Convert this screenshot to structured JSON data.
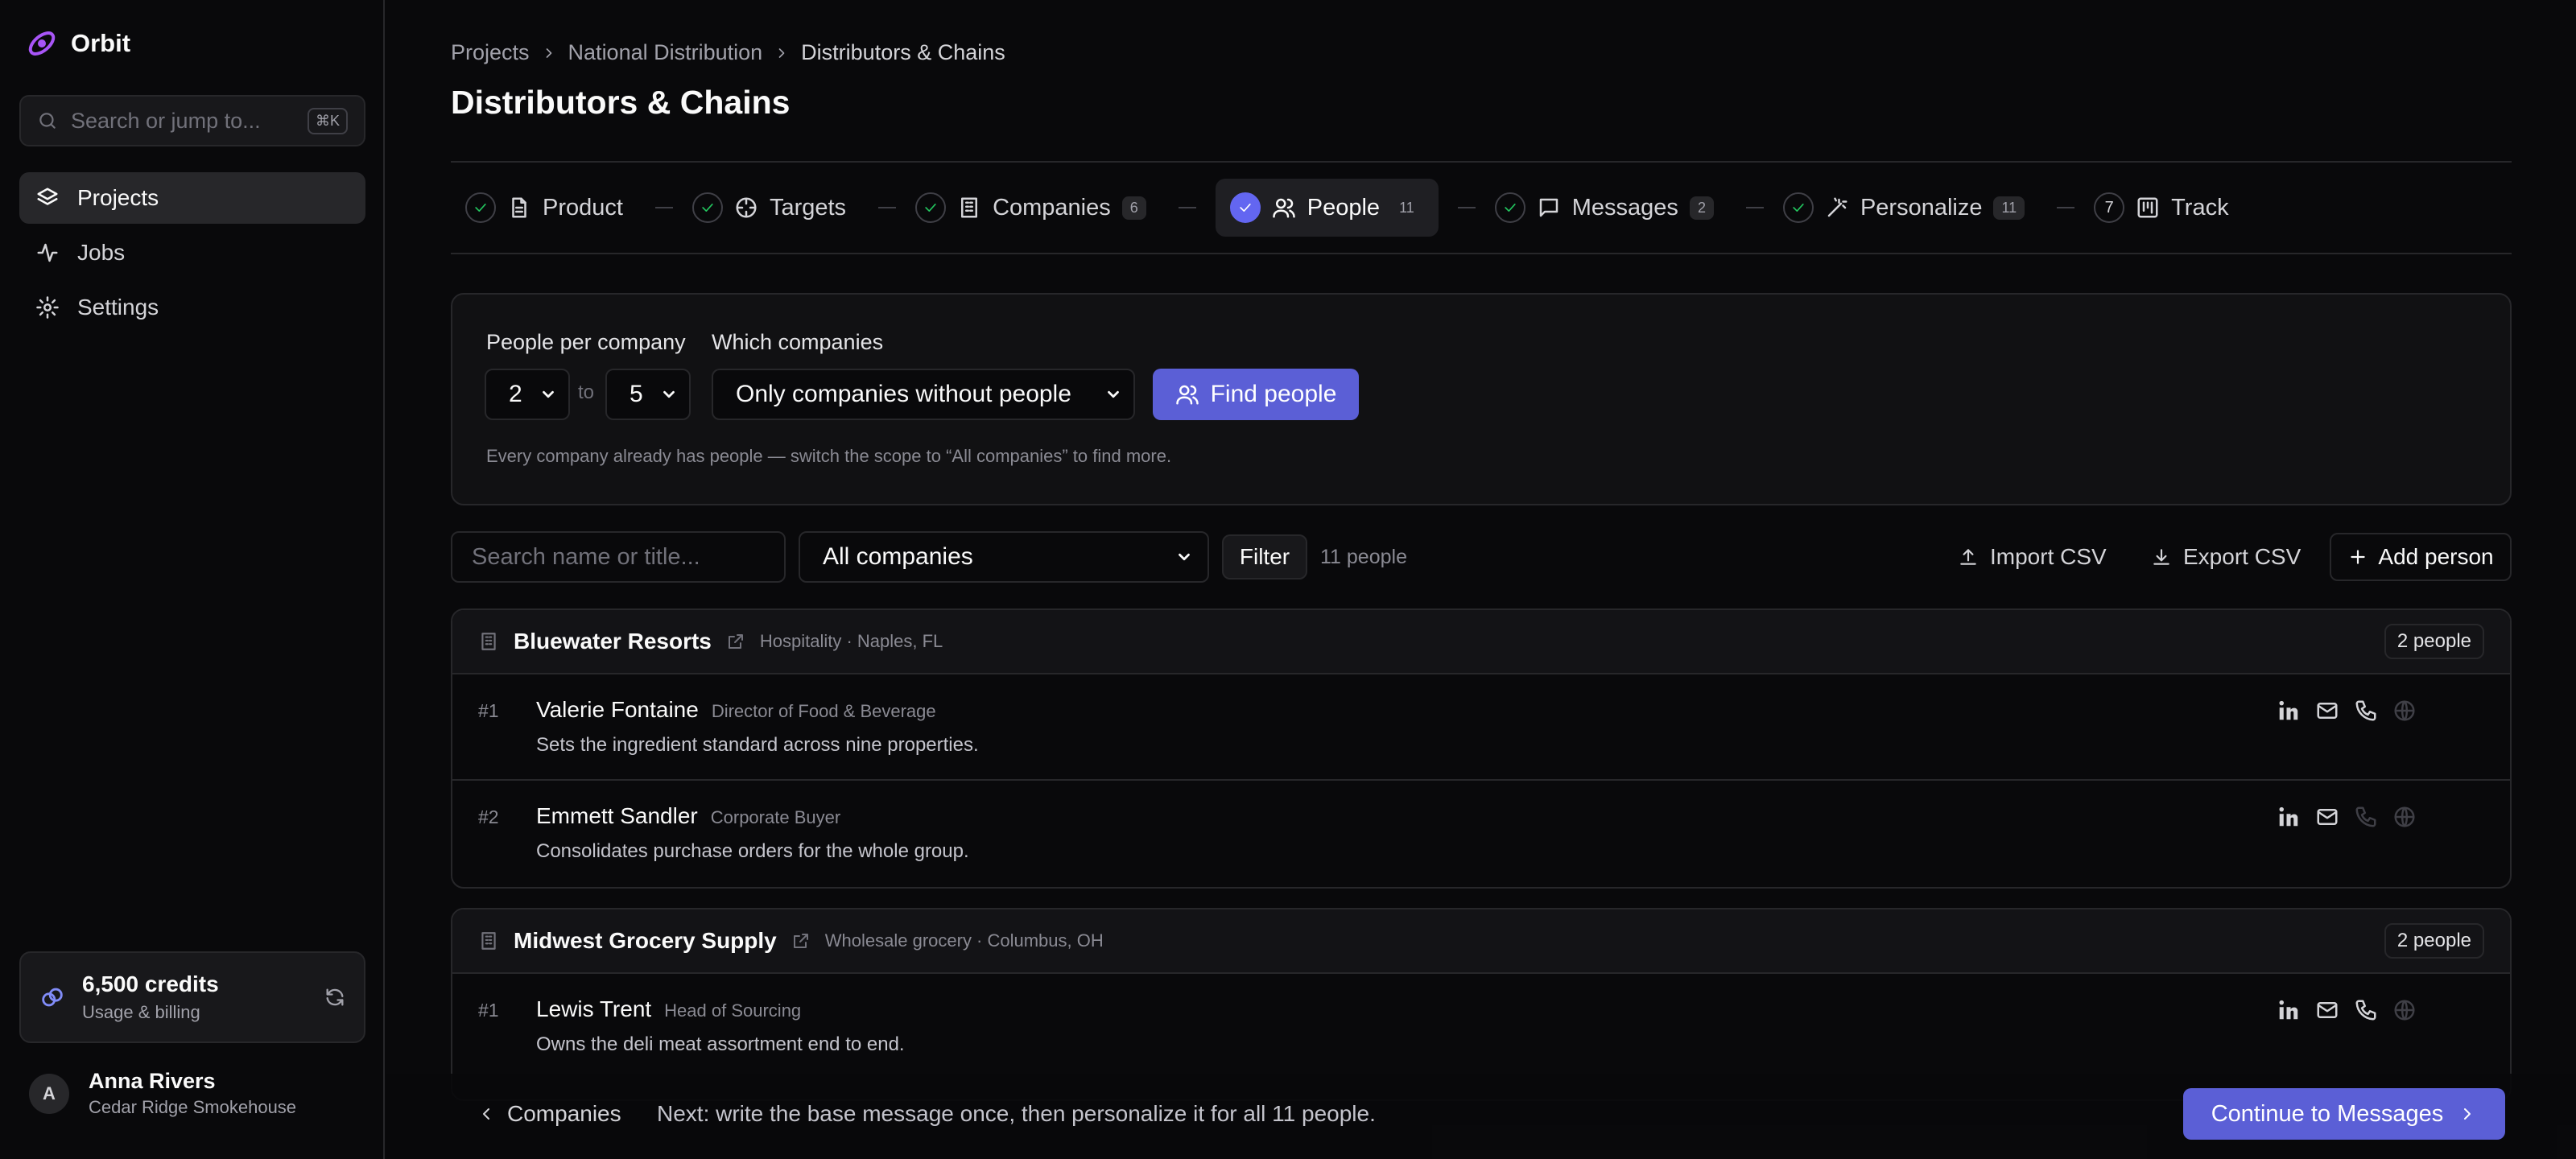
{
  "app": {
    "name": "Orbit"
  },
  "search": {
    "placeholder": "Search or jump to...",
    "shortcut": "⌘K"
  },
  "nav": [
    {
      "label": "Projects",
      "icon": "layers-icon",
      "active": true
    },
    {
      "label": "Jobs",
      "icon": "activity-icon",
      "active": false
    },
    {
      "label": "Settings",
      "icon": "gear-icon",
      "active": false
    }
  ],
  "credits": {
    "amount": "6,500 credits",
    "sub": "Usage & billing"
  },
  "user": {
    "initial": "A",
    "name": "Anna Rivers",
    "company": "Cedar Ridge Smokehouse"
  },
  "breadcrumb": [
    "Projects",
    "National Distribution",
    "Distributors & Chains"
  ],
  "page": {
    "title": "Distributors & Chains"
  },
  "steps": [
    {
      "label": "Product",
      "count": "",
      "state": "done",
      "icon": "document-icon"
    },
    {
      "label": "Targets",
      "count": "",
      "state": "done",
      "icon": "crosshair-icon"
    },
    {
      "label": "Companies",
      "count": "6",
      "state": "done",
      "icon": "building-icon"
    },
    {
      "label": "People",
      "count": "11",
      "state": "active",
      "icon": "users-icon"
    },
    {
      "label": "Messages",
      "count": "2",
      "state": "done",
      "icon": "message-icon"
    },
    {
      "label": "Personalize",
      "count": "11",
      "state": "done",
      "icon": "wand-icon"
    },
    {
      "label": "Track",
      "count": "",
      "state": "7",
      "icon": "kanban-icon"
    }
  ],
  "finder": {
    "per_company_label": "People per company",
    "min": "2",
    "to": "to",
    "max": "5",
    "which_label": "Which companies",
    "which_value": "Only companies without people",
    "button": "Find people",
    "hint": "Every company already has people — switch the scope to “All companies” to find more."
  },
  "toolbar": {
    "search_placeholder": "Search name or title...",
    "company_filter": "All companies",
    "filter": "Filter",
    "count": "11 people",
    "import": "Import CSV",
    "export": "Export CSV",
    "add": "Add person"
  },
  "groups": [
    {
      "name": "Bluewater Resorts",
      "meta": "Hospitality · Naples, FL",
      "badge": "2 people",
      "people": [
        {
          "num": "#1",
          "name": "Valerie Fontaine",
          "title": "Director of Food & Beverage",
          "desc": "Sets the ingredient standard across nine properties.",
          "phone": true
        },
        {
          "num": "#2",
          "name": "Emmett Sandler",
          "title": "Corporate Buyer",
          "desc": "Consolidates purchase orders for the whole group.",
          "phone": false
        }
      ]
    },
    {
      "name": "Midwest Grocery Supply",
      "meta": "Wholesale grocery · Columbus, OH",
      "badge": "2 people",
      "people": [
        {
          "num": "#1",
          "name": "Lewis Trent",
          "title": "Head of Sourcing",
          "desc": "Owns the deli meat assortment end to end.",
          "phone": true
        }
      ]
    }
  ],
  "footer": {
    "back": "Companies",
    "next": "Next: write the base message once, then personalize it for all 11 people.",
    "continue": "Continue to Messages"
  },
  "colors": {
    "accent": "#5b5fd6",
    "brand": "#a855f7",
    "success": "#22c55e",
    "background": "#09090b"
  }
}
